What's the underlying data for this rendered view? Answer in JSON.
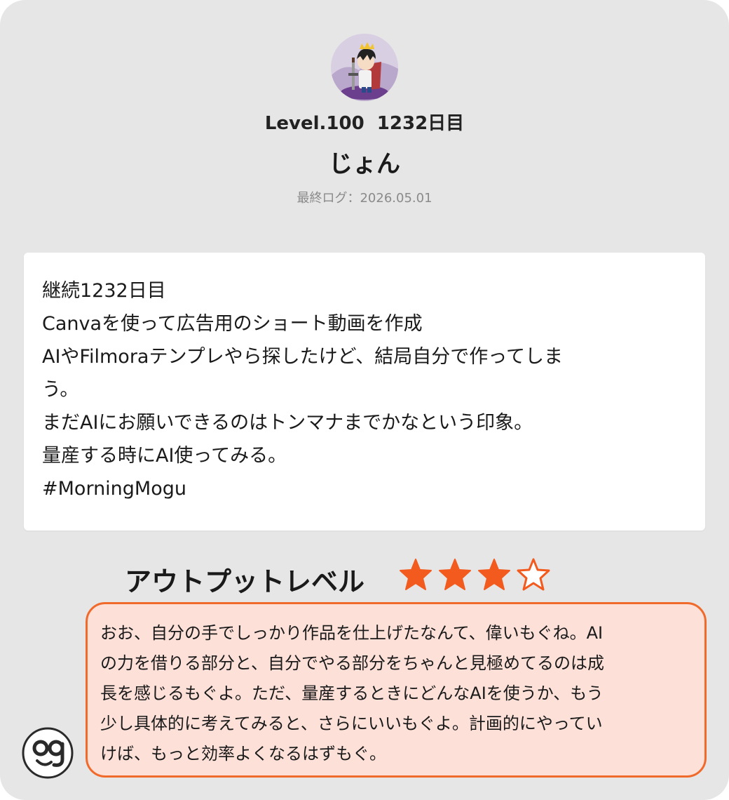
{
  "profile": {
    "level": "Level.100  1232日目",
    "name": "じょん",
    "last_log": "最終ログ：2026.05.01",
    "avatar": "knight-avatar"
  },
  "post": {
    "lines": [
      "継続1232日目",
      "Canvaを使って広告用のショート動画を作成",
      "AIやFilmoraテンプレやら探したけど、結局自分で作ってしま",
      "う。",
      "まだAIにお願いできるのはトンマナまでかなという印象。",
      "量産する時にAI使ってみる。",
      "#MorningMogu"
    ]
  },
  "output_level": {
    "label": "アウトプットレベル",
    "rating": 3,
    "max": 5,
    "filled_color": "#f25a1e"
  },
  "feedback": {
    "lines": [
      "おお、自分の手でしっかり作品を仕上げたなんて、偉いもぐね。AI",
      "の力を借りる部分と、自分でやる部分をちゃんと見極めてるのは成",
      "長を感じるもぐよ。ただ、量産するときにどんなAIを使うか、もう",
      "少し具体的に考えてみると、さらにいいもぐよ。計画的にやってい",
      "けば、もっと効率よくなるはずもぐ。"
    ],
    "border_color": "#f06a2c",
    "bg_color": "#fde0d8"
  },
  "mascot": {
    "icon": "mascot-og-icon"
  }
}
